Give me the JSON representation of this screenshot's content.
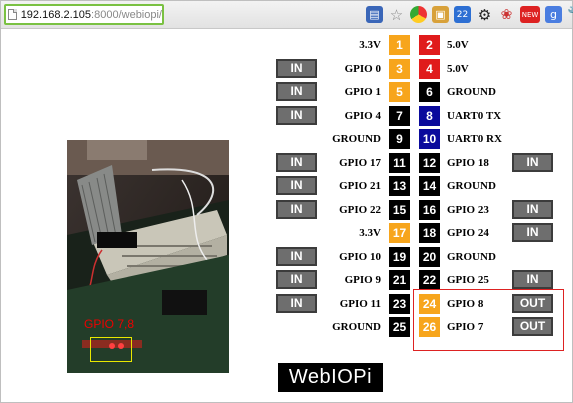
{
  "browser": {
    "url_host": "192.168.2.105",
    "url_path": ":8000/webiopi/",
    "toolbar_icons": [
      "rss-icon",
      "star-icon",
      "chrome-icon",
      "photos-icon",
      "calendar-icon",
      "gear-icon",
      "bug-icon",
      "new-icon",
      "translate-icon",
      "menu-icon"
    ],
    "new_badge": "NEW",
    "cal_text": "22"
  },
  "colors": {
    "black": "#000000",
    "orange": "#f7a51c",
    "red": "#e01b1b",
    "navy": "#0a0a9c",
    "button": "#6e6e6e"
  },
  "header": [
    {
      "left_label": "3.3V",
      "left_pin": "1",
      "left_color": "orange",
      "right_pin": "2",
      "right_color": "red",
      "right_label": "5.0V"
    },
    {
      "left_btn": "IN",
      "left_label": "GPIO 0",
      "left_pin": "3",
      "left_color": "orange",
      "right_pin": "4",
      "right_color": "red",
      "right_label": "5.0V"
    },
    {
      "left_btn": "IN",
      "left_label": "GPIO 1",
      "left_pin": "5",
      "left_color": "orange",
      "right_pin": "6",
      "right_color": "black",
      "right_label": "GROUND"
    },
    {
      "left_btn": "IN",
      "left_label": "GPIO 4",
      "left_pin": "7",
      "left_color": "black",
      "right_pin": "8",
      "right_color": "navy",
      "right_label": "UART0 TX"
    },
    {
      "left_label": "GROUND",
      "left_pin": "9",
      "left_color": "black",
      "right_pin": "10",
      "right_color": "navy",
      "right_label": "UART0 RX"
    },
    {
      "left_btn": "IN",
      "left_label": "GPIO 17",
      "left_pin": "11",
      "left_color": "black",
      "right_pin": "12",
      "right_color": "black",
      "right_label": "GPIO 18",
      "right_btn": "IN"
    },
    {
      "left_btn": "IN",
      "left_label": "GPIO 21",
      "left_pin": "13",
      "left_color": "black",
      "right_pin": "14",
      "right_color": "black",
      "right_label": "GROUND"
    },
    {
      "left_btn": "IN",
      "left_label": "GPIO 22",
      "left_pin": "15",
      "left_color": "black",
      "right_pin": "16",
      "right_color": "black",
      "right_label": "GPIO 23",
      "right_btn": "IN"
    },
    {
      "left_label": "3.3V",
      "left_pin": "17",
      "left_color": "orange",
      "right_pin": "18",
      "right_color": "black",
      "right_label": "GPIO 24",
      "right_btn": "IN"
    },
    {
      "left_btn": "IN",
      "left_label": "GPIO 10",
      "left_pin": "19",
      "left_color": "black",
      "right_pin": "20",
      "right_color": "black",
      "right_label": "GROUND"
    },
    {
      "left_btn": "IN",
      "left_label": "GPIO 9",
      "left_pin": "21",
      "left_color": "black",
      "right_pin": "22",
      "right_color": "black",
      "right_label": "GPIO 25",
      "right_btn": "IN"
    },
    {
      "left_btn": "IN",
      "left_label": "GPIO 11",
      "left_pin": "23",
      "left_color": "black",
      "right_pin": "24",
      "right_color": "orange",
      "right_label": "GPIO 8",
      "right_btn": "OUT"
    },
    {
      "left_label": "GROUND",
      "left_pin": "25",
      "left_color": "black",
      "right_pin": "26",
      "right_color": "orange",
      "right_label": "GPIO 7",
      "right_btn": "OUT"
    }
  ],
  "photo_caption": "GPIO 7,8",
  "logo": "WebIOPi"
}
